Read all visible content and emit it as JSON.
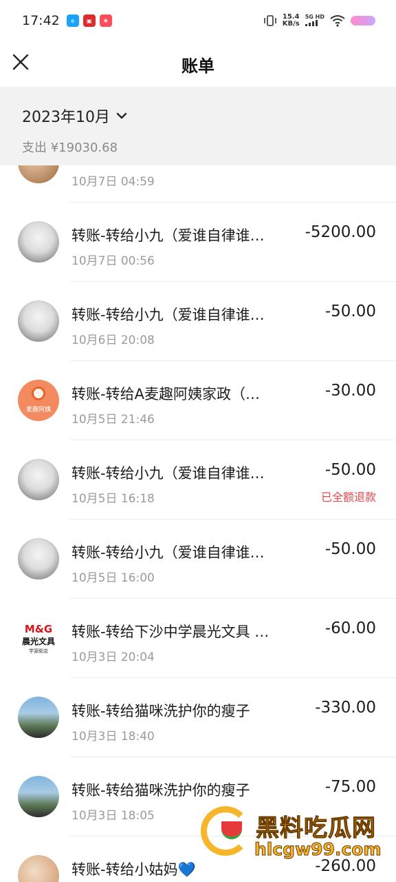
{
  "status_bar": {
    "time": "17:42",
    "net_speed_value": "15.4",
    "net_speed_unit": "KB/s",
    "net_type_top": "5G HD",
    "icons": [
      "app-e-icon",
      "app-store-icon",
      "app-shop-icon",
      "vibrate-icon",
      "signal-icon",
      "wifi-icon",
      "battery-icon"
    ]
  },
  "nav": {
    "title": "账单",
    "close_icon": "close-icon"
  },
  "summary": {
    "month": "2023年10月",
    "expense": "支出 ¥19030.68"
  },
  "transactions": [
    {
      "title": "",
      "time": "10月7日 04:59",
      "amount": "",
      "status": "",
      "avatar": "brown"
    },
    {
      "title": "转账-转给小九（爱谁自律谁…",
      "time": "10月7日 00:56",
      "amount": "-5200.00",
      "status": "",
      "avatar": "anime"
    },
    {
      "title": "转账-转给小九（爱谁自律谁…",
      "time": "10月6日 20:08",
      "amount": "-50.00",
      "status": "",
      "avatar": "anime"
    },
    {
      "title": "转账-转给A麦趣阿姨家政（…",
      "time": "10月5日 21:46",
      "amount": "-30.00",
      "status": "",
      "avatar": "orange"
    },
    {
      "title": "转账-转给小九（爱谁自律谁…",
      "time": "10月5日 16:18",
      "amount": "-50.00",
      "status": "已全额退款",
      "avatar": "anime"
    },
    {
      "title": "转账-转给小九（爱谁自律谁…",
      "time": "10月5日 16:00",
      "amount": "-50.00",
      "status": "",
      "avatar": "anime"
    },
    {
      "title": "转账-转给下沙中学晨光文具 …",
      "time": "10月3日 20:04",
      "amount": "-60.00",
      "status": "",
      "avatar": "mg"
    },
    {
      "title": "转账-转给猫咪洗护你的瘦子",
      "time": "10月3日 18:40",
      "amount": "-330.00",
      "status": "",
      "avatar": "photo"
    },
    {
      "title": "转账-转给猫咪洗护你的瘦子",
      "time": "10月3日 18:05",
      "amount": "-75.00",
      "status": "",
      "avatar": "photo"
    },
    {
      "title": "转账-转给小姑妈💙",
      "time": "",
      "amount": "-260.00",
      "status": "",
      "avatar": "peach"
    }
  ],
  "avatars": {
    "orange_text": "麦趣阿姨",
    "mg_logo": "M&G",
    "mg_sub": "晨光文具",
    "mg_tag": "学源街店"
  },
  "watermark": {
    "title": "黑料吃瓜网",
    "url": "hlcgw99.com"
  },
  "colors": {
    "refund": "#e5484d",
    "header_bg": "#f2f2f2",
    "watermark": "#f7b52c"
  }
}
